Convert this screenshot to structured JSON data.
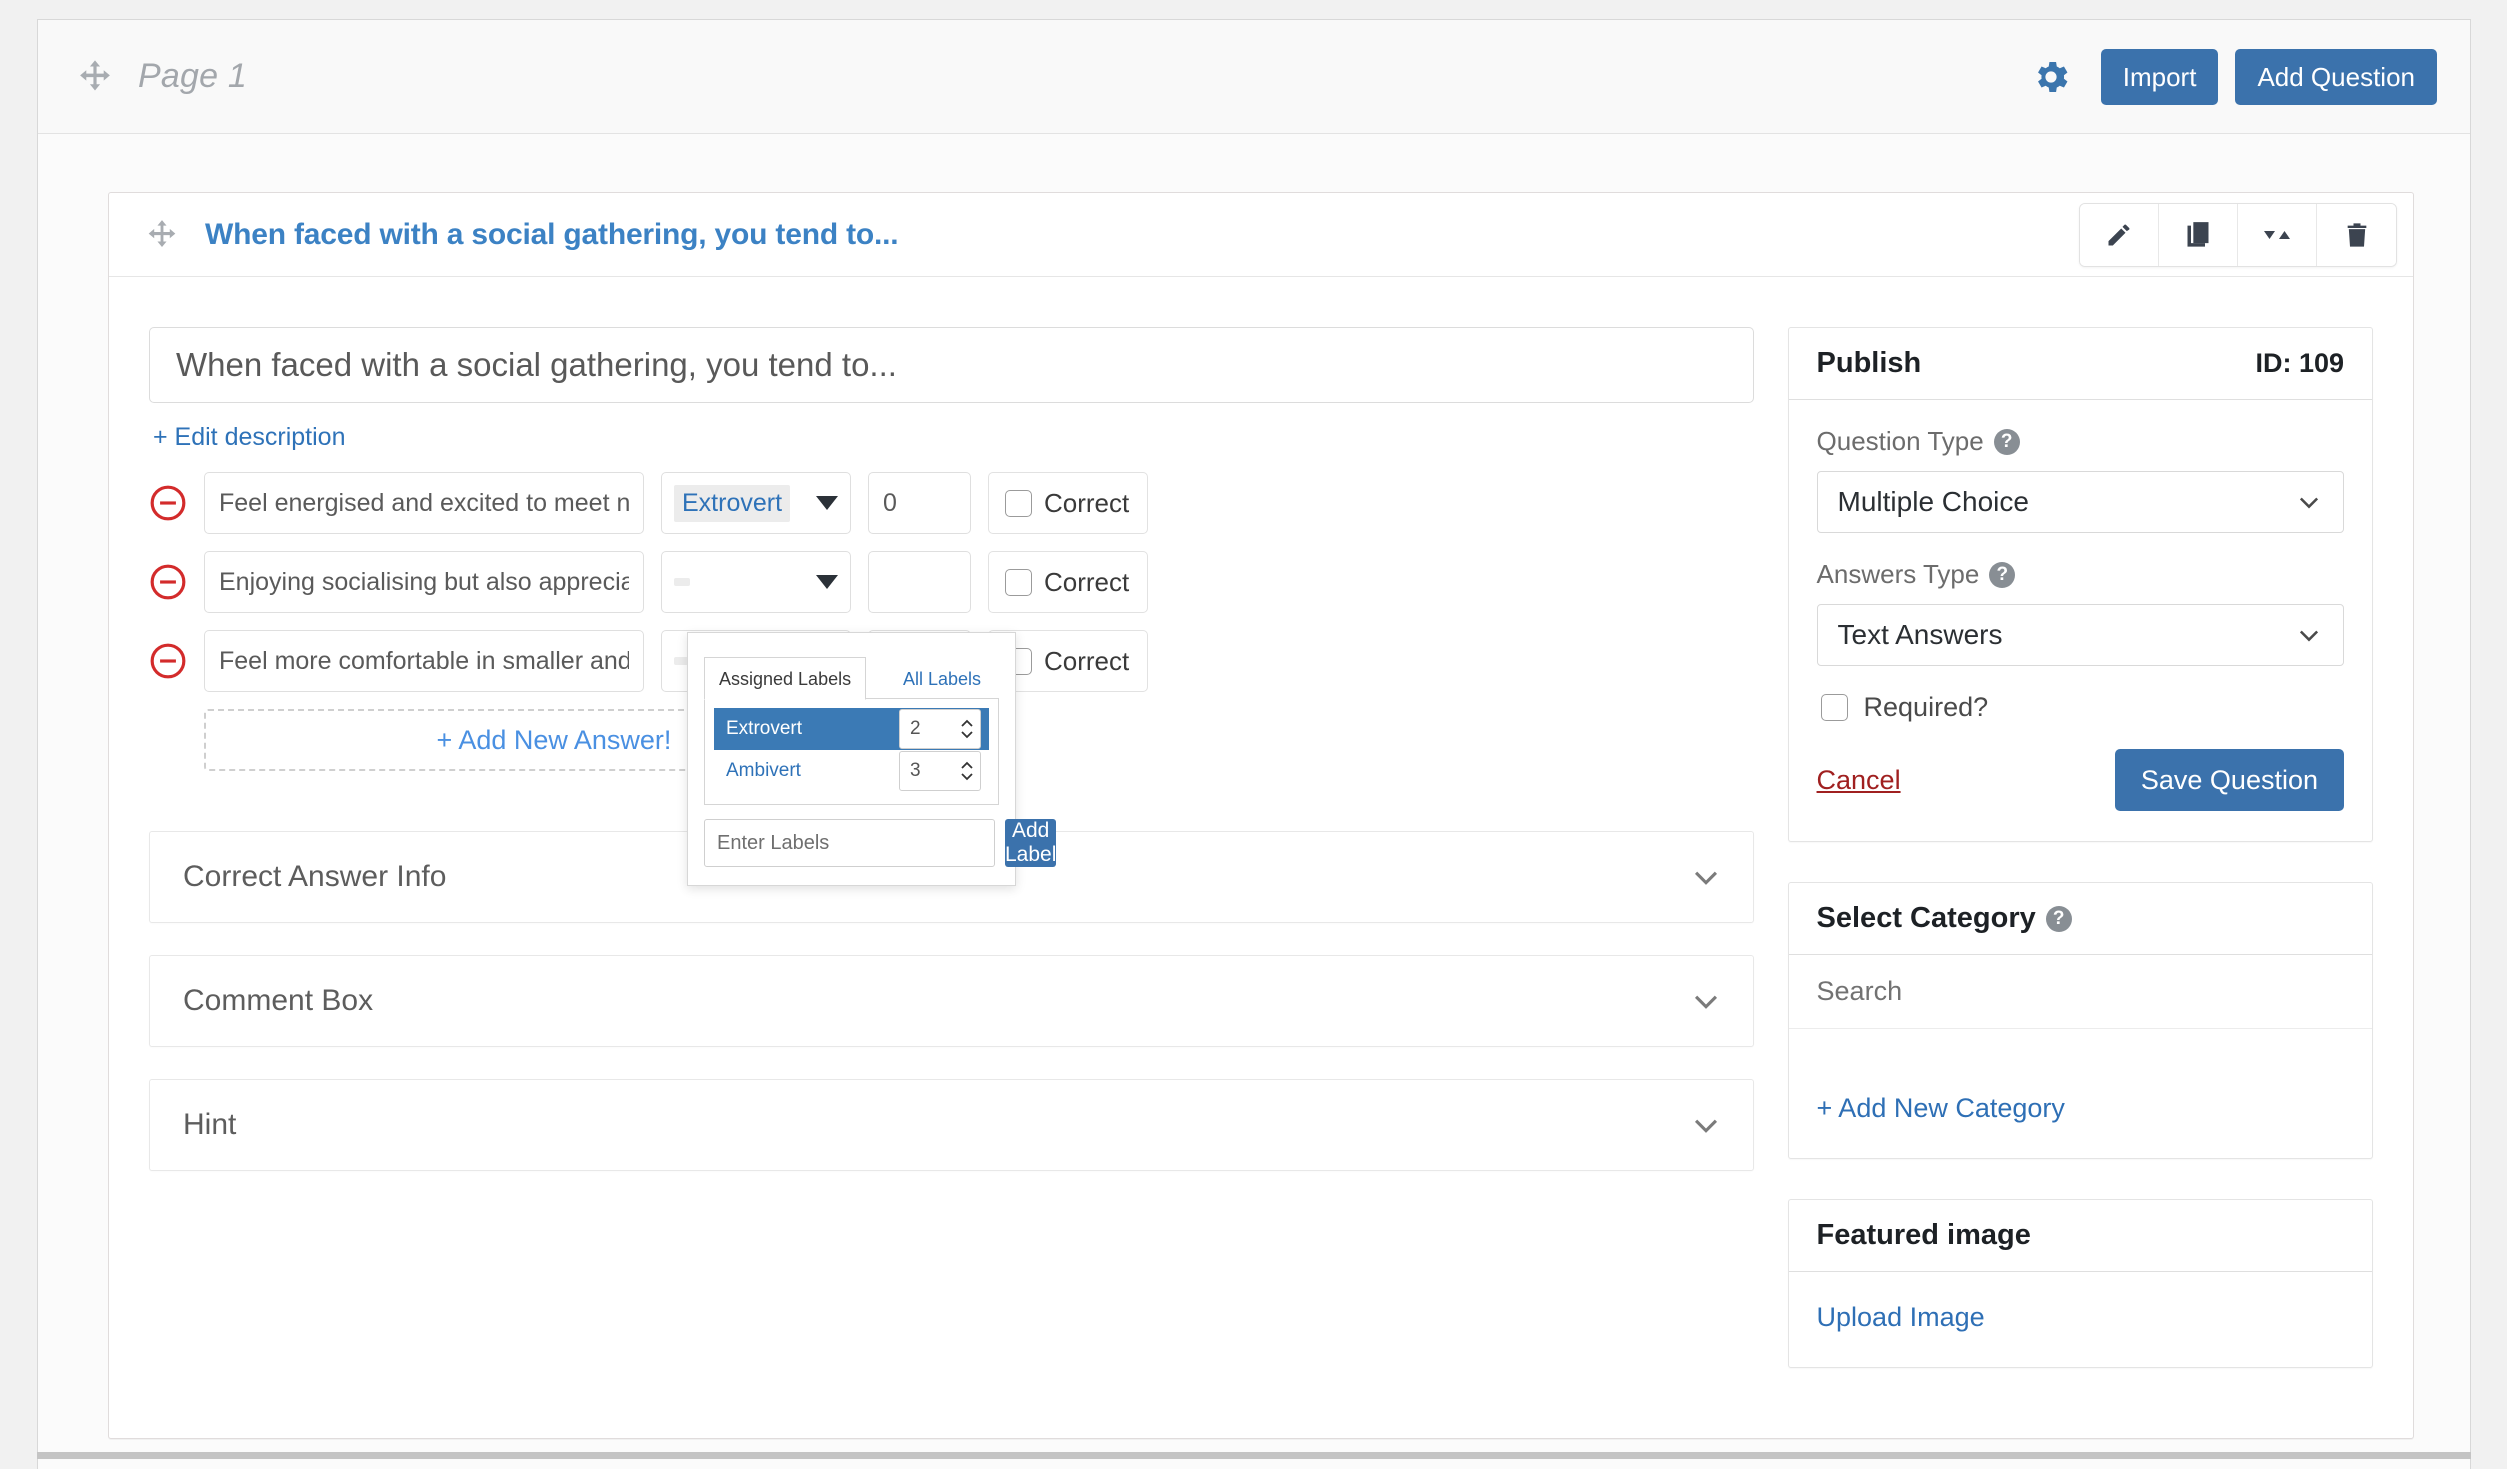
{
  "page_bar": {
    "move_icon": "move-icon",
    "title": "Page 1",
    "gear_icon": "gear-icon",
    "import_label": "Import",
    "add_question_label": "Add Question"
  },
  "question": {
    "header_title": "When faced with a social gathering, you tend to...",
    "actions": [
      {
        "icon": "pencil-icon",
        "name": "edit-question-button"
      },
      {
        "icon": "copy-icon",
        "name": "duplicate-question-button"
      },
      {
        "icon": "sort-icon",
        "name": "reorder-question-button"
      },
      {
        "icon": "trash-icon",
        "name": "delete-question-button"
      }
    ],
    "title_value": "When faced with a social gathering, you tend to...",
    "edit_description_label": "+ Edit description",
    "answers": [
      {
        "text": "Feel energised and excited to meet new people",
        "label": "Extrovert",
        "score": "0",
        "correct_label": "Correct",
        "correct_checked": false
      },
      {
        "text": "Enjoying socialising but also appreciate moments o",
        "label": "",
        "score": "",
        "correct_label": "Correct",
        "correct_checked": false
      },
      {
        "text": "Feel more comfortable in smaller and intimate setti",
        "label": "",
        "score": "",
        "correct_label": "Correct",
        "correct_checked": false
      }
    ],
    "add_answer_label": "+ Add New Answer!",
    "accordions": [
      {
        "label": "Correct Answer Info"
      },
      {
        "label": "Comment Box"
      },
      {
        "label": "Hint"
      }
    ]
  },
  "labels_popup": {
    "tabs": [
      {
        "label": "Assigned Labels",
        "active": true
      },
      {
        "label": "All Labels",
        "active": false
      }
    ],
    "labels": [
      {
        "name": "Extrovert",
        "count": "2",
        "selected": true
      },
      {
        "name": "Ambivert",
        "count": "3",
        "selected": false
      }
    ],
    "input_placeholder": "Enter Labels",
    "add_button_label": "Add Label"
  },
  "sidebar": {
    "publish": {
      "title": "Publish",
      "id_text": "ID: 109",
      "question_type_label": "Question Type",
      "question_type_value": "Multiple Choice",
      "answers_type_label": "Answers Type",
      "answers_type_value": "Text Answers",
      "required_label": "Required?",
      "required_checked": false,
      "cancel_label": "Cancel",
      "save_label": "Save Question"
    },
    "category": {
      "title": "Select Category",
      "search_placeholder": "Search",
      "add_new_label": "+ Add New Category"
    },
    "featured_image": {
      "title": "Featured image",
      "upload_label": "Upload Image"
    }
  },
  "colors": {
    "accent": "#3b72ac",
    "link": "#2e72b8",
    "danger": "#d32b2b",
    "cancel": "#a02020"
  }
}
